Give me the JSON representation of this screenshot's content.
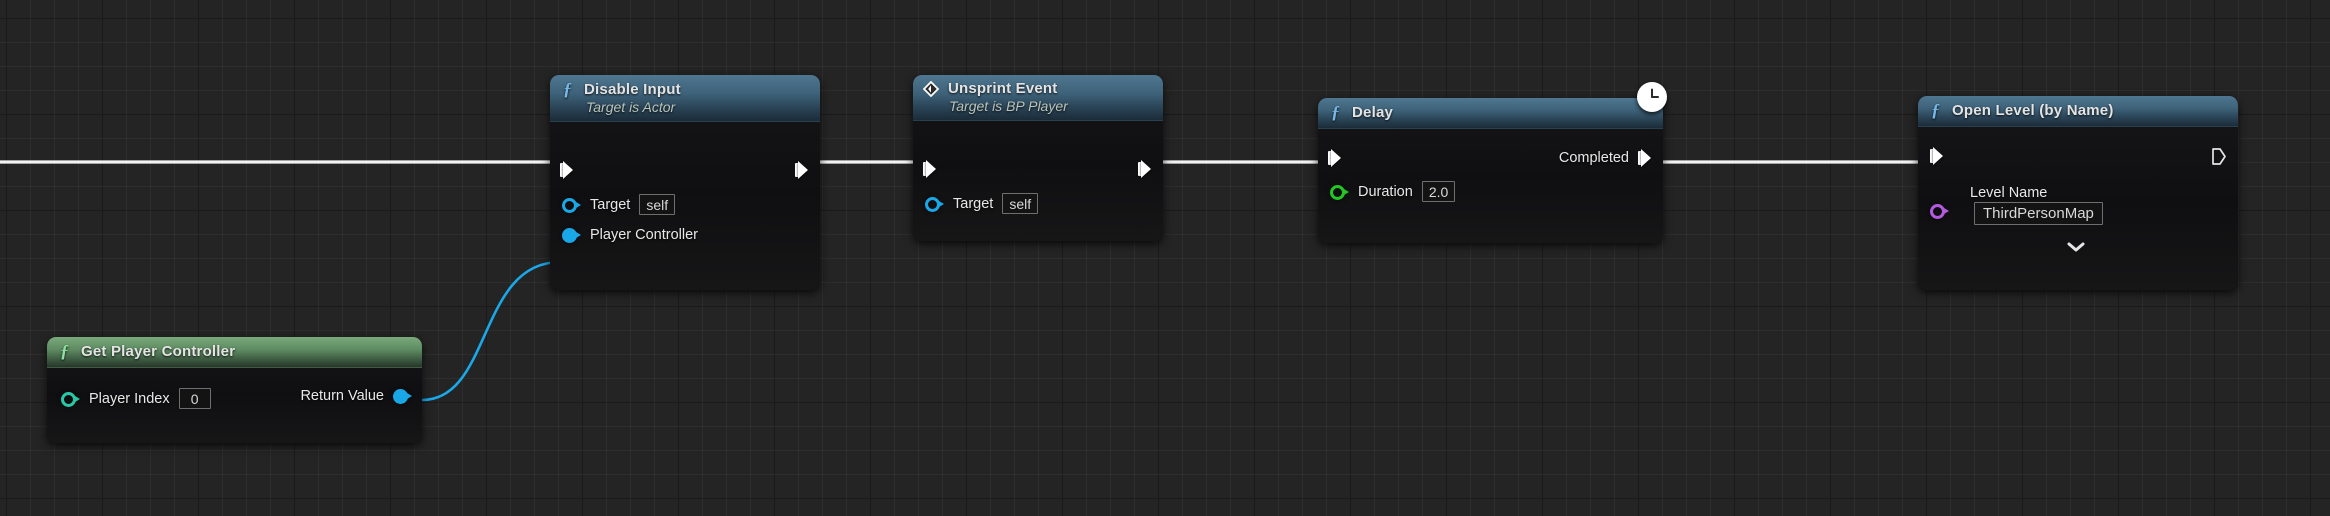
{
  "app": {
    "context": "unreal-blueprint-event-graph"
  },
  "colors": {
    "exec_wire": "#f2f2f2",
    "object_wire": "#1aa8e8",
    "pin_object": "#19a7e8",
    "pin_float": "#23c423",
    "pin_int": "#29c7a6",
    "pin_name": "#b45ae0",
    "title_blue": "#3d6178",
    "title_green": "#5e8b62",
    "graph_bg": "#242424"
  },
  "nodes": [
    {
      "id": "disable-input",
      "title": "Disable Input",
      "subtitle": "Target is Actor",
      "icon": "function-f-icon",
      "header_color": "blue",
      "exec_in": "",
      "exec_out": "",
      "params": [
        {
          "name": "Target",
          "label": "Target",
          "pin": "object",
          "value": "self"
        },
        {
          "name": "Player Controller",
          "label": "Player Controller",
          "pin": "object-filled",
          "value": null
        }
      ]
    },
    {
      "id": "unsprint-event",
      "title": "Unsprint Event",
      "subtitle": "Target is BP Player",
      "icon": "event-diamond-icon",
      "header_color": "blue",
      "exec_in": "",
      "exec_out": "",
      "params": [
        {
          "name": "Target",
          "label": "Target",
          "pin": "object",
          "value": "self"
        }
      ]
    },
    {
      "id": "delay",
      "title": "Delay",
      "subtitle": null,
      "icon": "function-f-icon",
      "header_color": "blue",
      "badge": "clock-icon",
      "exec_in": "",
      "exec_out": "Completed",
      "params": [
        {
          "name": "Duration",
          "label": "Duration",
          "pin": "float",
          "value": "2.0"
        }
      ]
    },
    {
      "id": "open-level-by-name",
      "title": "Open Level (by Name)",
      "subtitle": null,
      "icon": "function-f-icon",
      "header_color": "blue",
      "exec_in": "",
      "exec_out": "",
      "exec_out_connected": false,
      "expander": "chevron-down-icon",
      "params": [
        {
          "name": "Level Name",
          "label": "Level Name",
          "pin": "name",
          "value": "ThirdPersonMap"
        }
      ]
    },
    {
      "id": "get-player-controller",
      "title": "Get Player Controller",
      "subtitle": null,
      "icon": "function-f-icon",
      "header_color": "green",
      "params": [
        {
          "name": "Player Index",
          "label": "Player Index",
          "pin": "int",
          "value": "0"
        }
      ],
      "outputs": [
        {
          "name": "Return Value",
          "label": "Return Value",
          "pin": "object-filled"
        }
      ]
    }
  ],
  "connections": [
    {
      "from": "graph-edge-left",
      "to": "disable-input.exec-in",
      "type": "exec"
    },
    {
      "from": "disable-input.exec-out",
      "to": "unsprint-event.exec-in",
      "type": "exec"
    },
    {
      "from": "unsprint-event.exec-out",
      "to": "delay.exec-in",
      "type": "exec"
    },
    {
      "from": "delay.completed",
      "to": "open-level-by-name.exec-in",
      "type": "exec"
    },
    {
      "from": "get-player-controller.return-value",
      "to": "disable-input.player-controller",
      "type": "object"
    }
  ]
}
